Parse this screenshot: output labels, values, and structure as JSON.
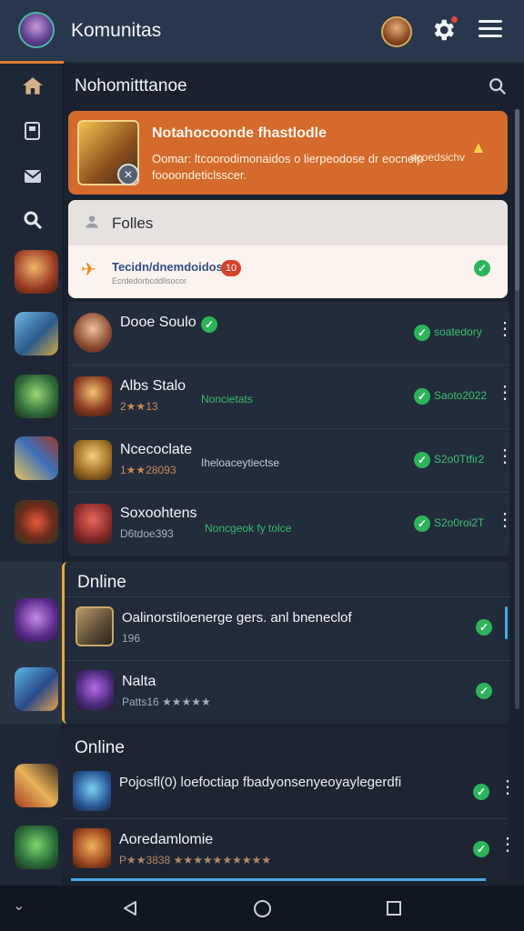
{
  "header": {
    "title": "Komunitas",
    "avatar_icon": "avatar-icon",
    "gear_icon": "gear-icon",
    "menu_icon": "hamburger-menu-icon"
  },
  "section": {
    "title": "Nohomitttanoe"
  },
  "notice": {
    "title": "Notahocoonde fhastlodle",
    "body": "Oomar: ltcoorodimonaidos o lierpeodose dr eocnelp foooondeticlsscer.",
    "tag": "acoedsichv"
  },
  "card": {
    "header_label": "Folles",
    "row_title": "Tecidn/dnemdoidos",
    "row_sub": "Ecrdedorbcddlisocor",
    "count": "10"
  },
  "list": [
    {
      "name": "Dooe Soulo",
      "meta": "",
      "status": "",
      "right": "soatedory"
    },
    {
      "name": "Albs Stalo",
      "meta": "2★★13",
      "status": "Noncietats",
      "right": "Saoto2022"
    },
    {
      "name": "Ncecoclate",
      "meta": "1★★28093",
      "status": "Iheloaceytiectse",
      "right": "S2o0Ttfir2"
    },
    {
      "name": "Soxoohtens",
      "meta": "D6tdoe393",
      "status": "Noncgeok fy tolce",
      "right": "S2o0roi2T"
    }
  ],
  "groups": [
    {
      "title": "Dnline",
      "rows": [
        {
          "name": "Oalinorstiloenerge gers. anl bneneclof",
          "meta": "196"
        },
        {
          "name": "Nalta",
          "meta": "Patts16 ★★★★★"
        }
      ]
    },
    {
      "title": "Online",
      "rows": [
        {
          "name": "Pojosfl(0)  loefoctiap fbadyonsenyeoyaylegerdfi",
          "meta": ""
        },
        {
          "name": "Aoredamlomie",
          "meta": "P★★3838  ★★★★★★★★★★"
        }
      ]
    }
  ]
}
